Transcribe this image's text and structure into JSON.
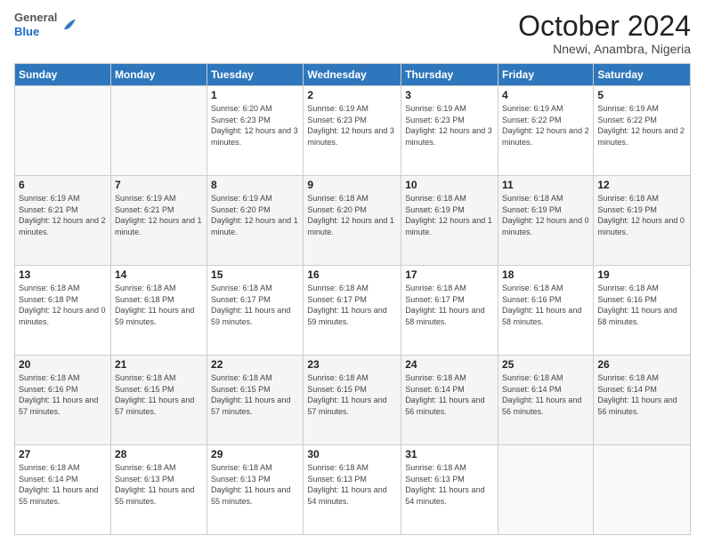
{
  "logo": {
    "general": "General",
    "blue": "Blue"
  },
  "header": {
    "month": "October 2024",
    "location": "Nnewi, Anambra, Nigeria"
  },
  "weekdays": [
    "Sunday",
    "Monday",
    "Tuesday",
    "Wednesday",
    "Thursday",
    "Friday",
    "Saturday"
  ],
  "weeks": [
    [
      {
        "day": "",
        "info": ""
      },
      {
        "day": "",
        "info": ""
      },
      {
        "day": "1",
        "info": "Sunrise: 6:20 AM\nSunset: 6:23 PM\nDaylight: 12 hours and 3 minutes."
      },
      {
        "day": "2",
        "info": "Sunrise: 6:19 AM\nSunset: 6:23 PM\nDaylight: 12 hours and 3 minutes."
      },
      {
        "day": "3",
        "info": "Sunrise: 6:19 AM\nSunset: 6:23 PM\nDaylight: 12 hours and 3 minutes."
      },
      {
        "day": "4",
        "info": "Sunrise: 6:19 AM\nSunset: 6:22 PM\nDaylight: 12 hours and 2 minutes."
      },
      {
        "day": "5",
        "info": "Sunrise: 6:19 AM\nSunset: 6:22 PM\nDaylight: 12 hours and 2 minutes."
      }
    ],
    [
      {
        "day": "6",
        "info": "Sunrise: 6:19 AM\nSunset: 6:21 PM\nDaylight: 12 hours and 2 minutes."
      },
      {
        "day": "7",
        "info": "Sunrise: 6:19 AM\nSunset: 6:21 PM\nDaylight: 12 hours and 1 minute."
      },
      {
        "day": "8",
        "info": "Sunrise: 6:19 AM\nSunset: 6:20 PM\nDaylight: 12 hours and 1 minute."
      },
      {
        "day": "9",
        "info": "Sunrise: 6:18 AM\nSunset: 6:20 PM\nDaylight: 12 hours and 1 minute."
      },
      {
        "day": "10",
        "info": "Sunrise: 6:18 AM\nSunset: 6:19 PM\nDaylight: 12 hours and 1 minute."
      },
      {
        "day": "11",
        "info": "Sunrise: 6:18 AM\nSunset: 6:19 PM\nDaylight: 12 hours and 0 minutes."
      },
      {
        "day": "12",
        "info": "Sunrise: 6:18 AM\nSunset: 6:19 PM\nDaylight: 12 hours and 0 minutes."
      }
    ],
    [
      {
        "day": "13",
        "info": "Sunrise: 6:18 AM\nSunset: 6:18 PM\nDaylight: 12 hours and 0 minutes."
      },
      {
        "day": "14",
        "info": "Sunrise: 6:18 AM\nSunset: 6:18 PM\nDaylight: 11 hours and 59 minutes."
      },
      {
        "day": "15",
        "info": "Sunrise: 6:18 AM\nSunset: 6:17 PM\nDaylight: 11 hours and 59 minutes."
      },
      {
        "day": "16",
        "info": "Sunrise: 6:18 AM\nSunset: 6:17 PM\nDaylight: 11 hours and 59 minutes."
      },
      {
        "day": "17",
        "info": "Sunrise: 6:18 AM\nSunset: 6:17 PM\nDaylight: 11 hours and 58 minutes."
      },
      {
        "day": "18",
        "info": "Sunrise: 6:18 AM\nSunset: 6:16 PM\nDaylight: 11 hours and 58 minutes."
      },
      {
        "day": "19",
        "info": "Sunrise: 6:18 AM\nSunset: 6:16 PM\nDaylight: 11 hours and 58 minutes."
      }
    ],
    [
      {
        "day": "20",
        "info": "Sunrise: 6:18 AM\nSunset: 6:16 PM\nDaylight: 11 hours and 57 minutes."
      },
      {
        "day": "21",
        "info": "Sunrise: 6:18 AM\nSunset: 6:15 PM\nDaylight: 11 hours and 57 minutes."
      },
      {
        "day": "22",
        "info": "Sunrise: 6:18 AM\nSunset: 6:15 PM\nDaylight: 11 hours and 57 minutes."
      },
      {
        "day": "23",
        "info": "Sunrise: 6:18 AM\nSunset: 6:15 PM\nDaylight: 11 hours and 57 minutes."
      },
      {
        "day": "24",
        "info": "Sunrise: 6:18 AM\nSunset: 6:14 PM\nDaylight: 11 hours and 56 minutes."
      },
      {
        "day": "25",
        "info": "Sunrise: 6:18 AM\nSunset: 6:14 PM\nDaylight: 11 hours and 56 minutes."
      },
      {
        "day": "26",
        "info": "Sunrise: 6:18 AM\nSunset: 6:14 PM\nDaylight: 11 hours and 56 minutes."
      }
    ],
    [
      {
        "day": "27",
        "info": "Sunrise: 6:18 AM\nSunset: 6:14 PM\nDaylight: 11 hours and 55 minutes."
      },
      {
        "day": "28",
        "info": "Sunrise: 6:18 AM\nSunset: 6:13 PM\nDaylight: 11 hours and 55 minutes."
      },
      {
        "day": "29",
        "info": "Sunrise: 6:18 AM\nSunset: 6:13 PM\nDaylight: 11 hours and 55 minutes."
      },
      {
        "day": "30",
        "info": "Sunrise: 6:18 AM\nSunset: 6:13 PM\nDaylight: 11 hours and 54 minutes."
      },
      {
        "day": "31",
        "info": "Sunrise: 6:18 AM\nSunset: 6:13 PM\nDaylight: 11 hours and 54 minutes."
      },
      {
        "day": "",
        "info": ""
      },
      {
        "day": "",
        "info": ""
      }
    ]
  ]
}
